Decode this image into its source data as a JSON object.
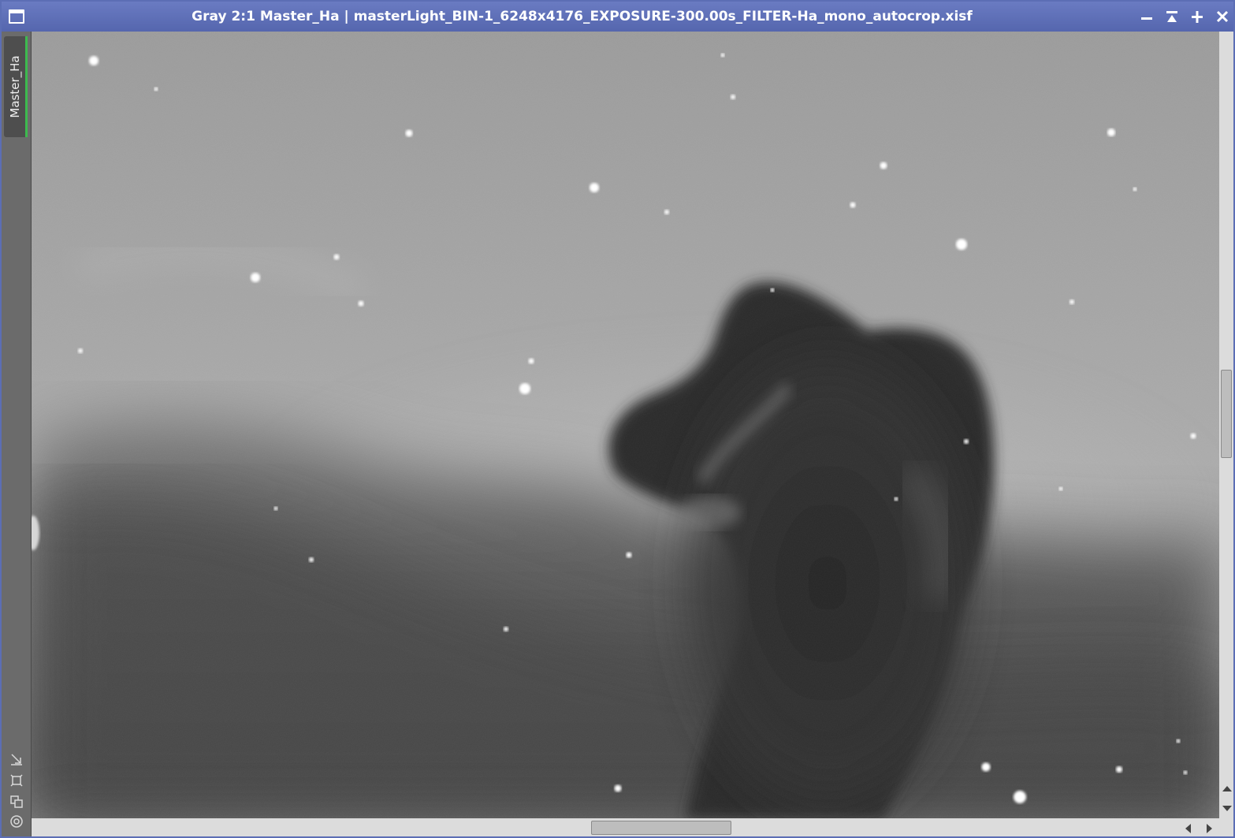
{
  "window": {
    "title": "Gray 2:1 Master_Ha | masterLight_BIN-1_6248x4176_EXPOSURE-300.00s_FILTER-Ha_mono_autocrop.xisf",
    "accent_color": "#5c6eb5",
    "buttons": [
      "minimize-icon",
      "shade-icon",
      "maximize-icon",
      "close-icon"
    ]
  },
  "sidebar": {
    "view_tab_label": "Master_Ha",
    "tab_indicator_color": "#3dba4e",
    "tools": [
      "fit-view-icon",
      "zoom-to-fit-icon",
      "clone-view-icon",
      "target-icon"
    ]
  },
  "image": {
    "description_icon": "horsehead-nebula-image",
    "mode": "grayscale"
  }
}
